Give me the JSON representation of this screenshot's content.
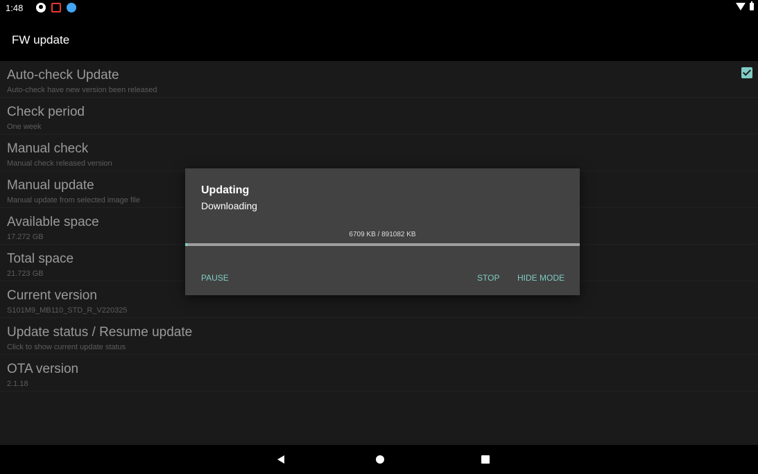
{
  "status_bar": {
    "time": "1:48",
    "icons": [
      "notification-icon",
      "app-icon",
      "browser-icon"
    ],
    "right_icons": [
      "wifi-icon",
      "battery-icon"
    ]
  },
  "header": {
    "title": "FW update"
  },
  "settings": [
    {
      "title": "Auto-check Update",
      "summary": "Auto-check have new version been released",
      "checked": true
    },
    {
      "title": "Check period",
      "summary": "One week"
    },
    {
      "title": "Manual check",
      "summary": "Manual check released version"
    },
    {
      "title": "Manual update",
      "summary": "Manual update from selected image file"
    },
    {
      "title": "Available space",
      "summary": "17.272 GB"
    },
    {
      "title": "Total space",
      "summary": "21.723 GB"
    },
    {
      "title": "Current version",
      "summary": "S101M9_MB110_STD_R_V220325"
    },
    {
      "title": "Update status / Resume update",
      "summary": "Click to show current update status"
    },
    {
      "title": "OTA version",
      "summary": "2.1.18"
    }
  ],
  "dialog": {
    "title": "Updating",
    "subtitle": "Downloading",
    "progress_text": "6709 KB / 891082 KB",
    "progress_fraction": 0.0075,
    "buttons": {
      "pause": "PAUSE",
      "stop": "STOP",
      "hide": "HIDE MODE"
    }
  },
  "colors": {
    "accent": "#80cbc4",
    "dialog_bg": "#424242",
    "background": "#1a1a1a"
  },
  "nav_bar": {
    "icons": [
      "back-icon",
      "home-icon",
      "recents-icon"
    ]
  }
}
